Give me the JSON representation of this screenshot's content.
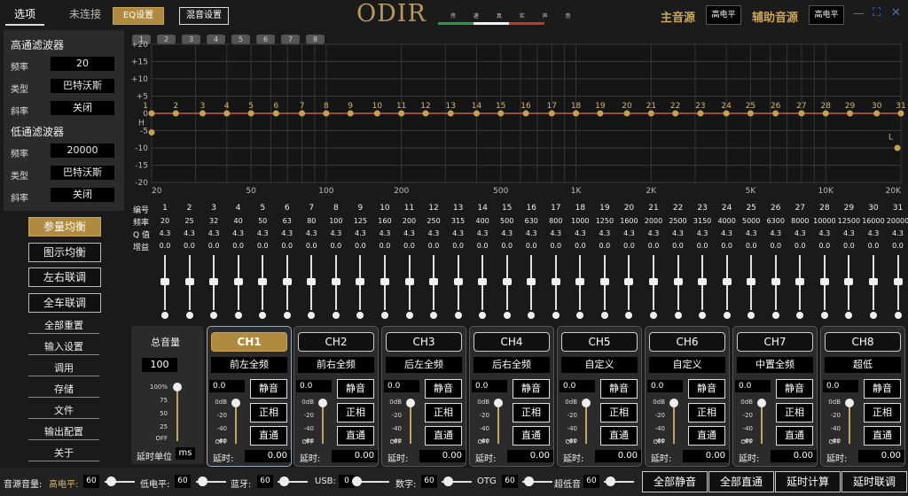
{
  "top": {
    "tabs": [
      {
        "label": "选项",
        "state": "selected"
      },
      {
        "label": "未连接",
        "state": "dim"
      },
      {
        "label": "EQ设置",
        "state": "active"
      },
      {
        "label": "混音设置",
        "state": "outlined"
      }
    ],
    "logo": "ODIR",
    "tagline": "传 递 真 实 声 音",
    "main_source_label": "主音源",
    "main_source_value": "高电平",
    "aux_source_label": "辅助音源",
    "aux_source_value": "高电平",
    "window_icons": [
      "minimize-icon",
      "fullscreen-icon",
      "close-icon"
    ],
    "accent": "#b08a3e"
  },
  "filters": {
    "highpass": {
      "title": "高通滤波器",
      "freq_label": "频率",
      "freq": "20",
      "type_label": "类型",
      "type": "巴特沃斯",
      "slope_label": "斜率",
      "slope": "关闭"
    },
    "lowpass": {
      "title": "低通滤波器",
      "freq_label": "频率",
      "freq": "20000",
      "type_label": "类型",
      "type": "巴特沃斯",
      "slope_label": "斜率",
      "slope": "关闭"
    }
  },
  "menu": {
    "buttons": [
      "参量均衡",
      "图示均衡",
      "左右联调",
      "全车联调"
    ],
    "selected_index": 0,
    "links": [
      "全部重置",
      "输入设置",
      "调用",
      "存储",
      "文件",
      "输出配置",
      "关于"
    ]
  },
  "graph": {
    "band_tabs": [
      "1",
      "2",
      "3",
      "4",
      "5",
      "6",
      "7",
      "8"
    ],
    "y_ticks": [
      "+20",
      "+15",
      "+10",
      "+5",
      "0",
      "-5",
      "-10",
      "-15",
      "-20"
    ],
    "y_range": [
      -20,
      20
    ],
    "x_ticks": [
      "20",
      "50",
      "100",
      "200",
      "500",
      "1K",
      "2K",
      "5K",
      "10K",
      "20K"
    ],
    "x_tick_freqs": [
      20,
      50,
      100,
      200,
      500,
      1000,
      2000,
      5000,
      10000,
      20000
    ],
    "hp_marker": "H",
    "lp_marker": "L",
    "line_color": "#c0613a",
    "point_color": "#c8a050"
  },
  "bands": {
    "row_labels": {
      "num": "编号",
      "freq": "频率",
      "q": "Q 值",
      "gain": "增益"
    },
    "numbers": [
      "1",
      "2",
      "3",
      "4",
      "5",
      "6",
      "7",
      "8",
      "9",
      "10",
      "11",
      "12",
      "13",
      "14",
      "15",
      "16",
      "17",
      "18",
      "19",
      "20",
      "21",
      "22",
      "23",
      "24",
      "25",
      "26",
      "27",
      "28",
      "29",
      "30",
      "31"
    ],
    "freqs": [
      "20",
      "25",
      "32",
      "40",
      "50",
      "63",
      "80",
      "100",
      "125",
      "160",
      "200",
      "250",
      "315",
      "400",
      "500",
      "630",
      "800",
      "1000",
      "1250",
      "1600",
      "2000",
      "2500",
      "3150",
      "4000",
      "5000",
      "6300",
      "8000",
      "10000",
      "12500",
      "16000",
      "20000"
    ],
    "q": "4.3",
    "gain": "0.0",
    "gain_values": [
      0,
      0,
      0,
      0,
      0,
      0,
      0,
      0,
      0,
      0,
      0,
      0,
      0,
      0,
      0,
      0,
      0,
      0,
      0,
      0,
      0,
      0,
      0,
      0,
      0,
      0,
      0,
      0,
      0,
      0,
      0
    ]
  },
  "master": {
    "label": "总音量",
    "value": "100",
    "scale": [
      "100%",
      "75",
      "50",
      "25",
      "OFF"
    ],
    "delay_unit_label": "延时单位",
    "delay_unit": "ms",
    "level": 1.0
  },
  "channels": [
    {
      "label": "CH1",
      "name": "前左全频",
      "value": "0.0",
      "mute": "静音",
      "phase": "正相",
      "direct": "直通",
      "delay_label": "延时:",
      "delay": "0.00",
      "selected": true
    },
    {
      "label": "CH2",
      "name": "前右全频",
      "value": "0.0",
      "mute": "静音",
      "phase": "正相",
      "direct": "直通",
      "delay_label": "延时:",
      "delay": "0.00",
      "selected": false
    },
    {
      "label": "CH3",
      "name": "后左全频",
      "value": "0.0",
      "mute": "静音",
      "phase": "正相",
      "direct": "直通",
      "delay_label": "延时:",
      "delay": "0.00",
      "selected": false
    },
    {
      "label": "CH4",
      "name": "后右全频",
      "value": "0.0",
      "mute": "静音",
      "phase": "正相",
      "direct": "直通",
      "delay_label": "延时:",
      "delay": "0.00",
      "selected": false
    },
    {
      "label": "CH5",
      "name": "自定义",
      "value": "0.0",
      "mute": "静音",
      "phase": "正相",
      "direct": "直通",
      "delay_label": "延时:",
      "delay": "0.00",
      "selected": false
    },
    {
      "label": "CH6",
      "name": "自定义",
      "value": "0.0",
      "mute": "静音",
      "phase": "正相",
      "direct": "直通",
      "delay_label": "延时:",
      "delay": "0.00",
      "selected": false
    },
    {
      "label": "CH7",
      "name": "中置全频",
      "value": "0.0",
      "mute": "静音",
      "phase": "正相",
      "direct": "直通",
      "delay_label": "延时:",
      "delay": "0.00",
      "selected": false
    },
    {
      "label": "CH8",
      "name": "超低",
      "value": "0.0",
      "mute": "静音",
      "phase": "正相",
      "direct": "直通",
      "delay_label": "延时:",
      "delay": "0.00",
      "selected": false
    }
  ],
  "channel_scale": [
    "0dB",
    "-20",
    "-40",
    "-60",
    "OFF"
  ],
  "bottom": {
    "source_vol_label": "音源音量:",
    "sources": [
      {
        "label": "高电平:",
        "value": "60"
      },
      {
        "label": "低电平:",
        "value": "60"
      },
      {
        "label": "蓝牙:",
        "value": "60"
      },
      {
        "label": "USB:",
        "value": "0"
      },
      {
        "label": "数字:",
        "value": "60"
      },
      {
        "label": "OTG",
        "value": "60"
      },
      {
        "label": "超低音",
        "value": "60"
      }
    ],
    "buttons": [
      "全部静音",
      "全部直通",
      "延时计算",
      "延时联调"
    ]
  }
}
